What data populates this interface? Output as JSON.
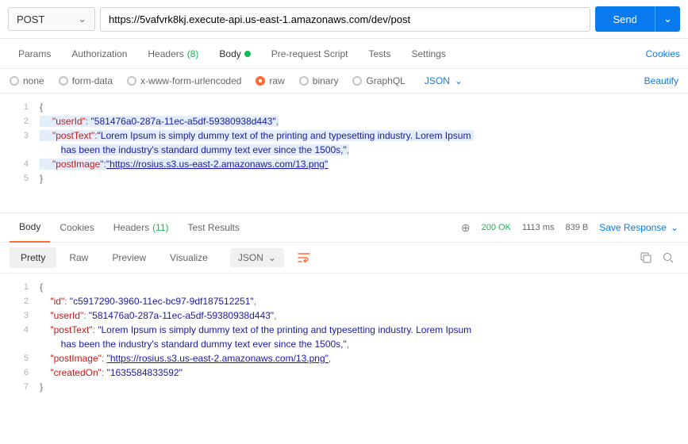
{
  "request": {
    "method": "POST",
    "url": "https://5vafvrk8kj.execute-api.us-east-1.amazonaws.com/dev/post",
    "send_label": "Send"
  },
  "tabs": {
    "params": "Params",
    "auth": "Authorization",
    "headers": "Headers",
    "headers_count": "(8)",
    "body": "Body",
    "prerequest": "Pre-request Script",
    "tests": "Tests",
    "settings": "Settings",
    "cookies": "Cookies"
  },
  "bodyTypes": {
    "none": "none",
    "formdata": "form-data",
    "xform": "x-www-form-urlencoded",
    "raw": "raw",
    "binary": "binary",
    "graphql": "GraphQL",
    "lang": "JSON",
    "beautify": "Beautify"
  },
  "reqBody": {
    "l1": "{",
    "l2_key": "\"userId\"",
    "l2_val": "\"581476a0-287a-11ec-a5df-59380938d443\"",
    "l3_key": "\"postText\"",
    "l3_val": "\"Lorem Ipsum is simply dummy text of the printing and typesetting industry. Lorem Ipsum ",
    "l3b": "has been the industry's standard dummy text ever since the 1500s,\"",
    "l4_key": "\"postImage\"",
    "l4_val": "\"https://rosius.s3.us-east-2.amazonaws.com/13.png\"",
    "l5": "}"
  },
  "respTabs": {
    "body": "Body",
    "cookies": "Cookies",
    "headers": "Headers",
    "headers_count": "(11)",
    "results": "Test Results",
    "status_code": "200 OK",
    "time": "1113 ms",
    "size": "839 B",
    "save": "Save Response"
  },
  "viewBar": {
    "pretty": "Pretty",
    "raw": "Raw",
    "preview": "Preview",
    "visualize": "Visualize",
    "lang": "JSON"
  },
  "respBody": {
    "l1": "{",
    "l2_key": "\"id\"",
    "l2_val": "\"c5917290-3960-11ec-bc97-9df187512251\"",
    "l3_key": "\"userId\"",
    "l3_val": "\"581476a0-287a-11ec-a5df-59380938d443\"",
    "l4_key": "\"postText\"",
    "l4_val": "\"Lorem Ipsum is simply dummy text of the printing and typesetting industry. Lorem Ipsum ",
    "l4b": "has been the industry's standard dummy text ever since the 1500s,\"",
    "l5_key": "\"postImage\"",
    "l5_val": "\"https://rosius.s3.us-east-2.amazonaws.com/13.png\"",
    "l6_key": "\"createdOn\"",
    "l6_val": "\"1635584833592\"",
    "l7": "}"
  }
}
